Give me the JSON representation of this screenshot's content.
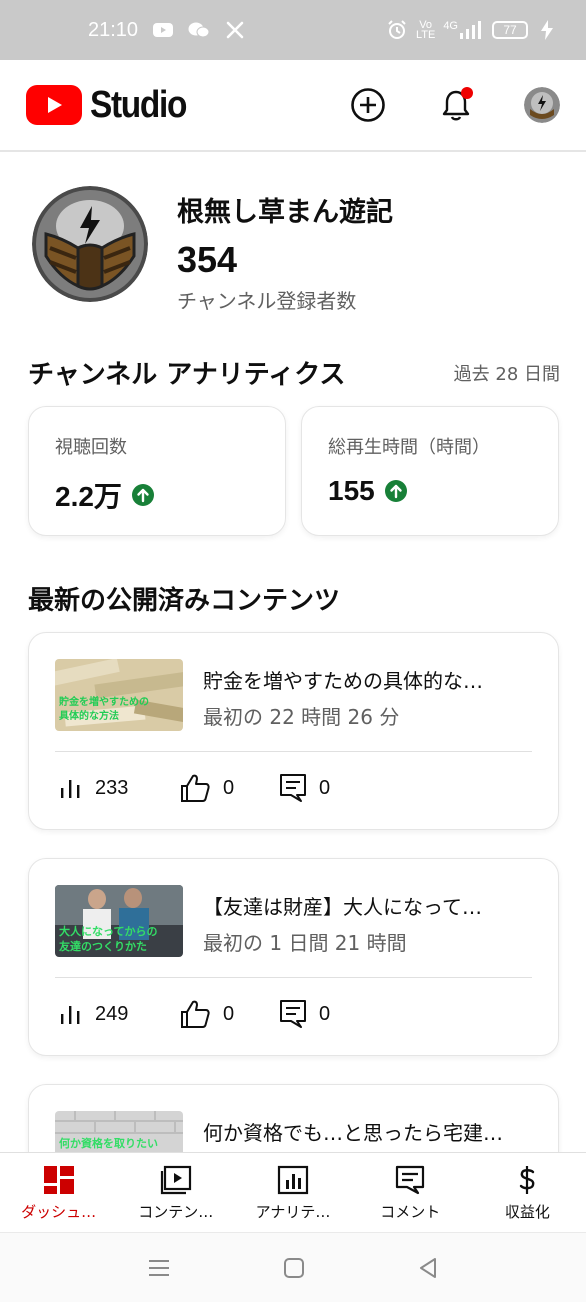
{
  "status_bar": {
    "time": "21:10",
    "network_text_top": "Vo",
    "network_text_bottom": "LTE",
    "signal_text": "4G",
    "battery": "77"
  },
  "app_bar": {
    "logo_text": "Studio"
  },
  "channel": {
    "name": "根無し草まん遊記",
    "subscriber_count": "354",
    "subscriber_label": "チャンネル登録者数"
  },
  "analytics": {
    "title": "チャンネル アナリティクス",
    "period": "過去 28 日間",
    "cards": [
      {
        "label": "視聴回数",
        "value": "2.2万"
      },
      {
        "label": "総再生時間（時間）",
        "value": "155"
      }
    ]
  },
  "latest": {
    "title": "最新の公開済みコンテンツ",
    "items": [
      {
        "title": "貯金を増やすための具体的な…",
        "time": "最初の 22 時間 26 分",
        "views": "233",
        "likes": "0",
        "comments": "0"
      },
      {
        "title": "【友達は財産】大人になって…",
        "time": "最初の 1 日間 21 時間",
        "views": "249",
        "likes": "0",
        "comments": "0"
      },
      {
        "title": "何か資格でも…と思ったら宅建…"
      }
    ]
  },
  "bottom_nav": {
    "items": [
      {
        "label": "ダッシュ…",
        "icon": "dashboard-icon",
        "active": true
      },
      {
        "label": "コンテン…",
        "icon": "content-icon"
      },
      {
        "label": "アナリテ…",
        "icon": "analytics-icon"
      },
      {
        "label": "コメント",
        "icon": "comment-icon"
      },
      {
        "label": "収益化",
        "icon": "dollar-icon"
      }
    ]
  },
  "colors": {
    "accent_red": "#ff0000",
    "active_nav": "#cc0000",
    "trend_up": "#188038",
    "secondary_text": "#606060"
  }
}
